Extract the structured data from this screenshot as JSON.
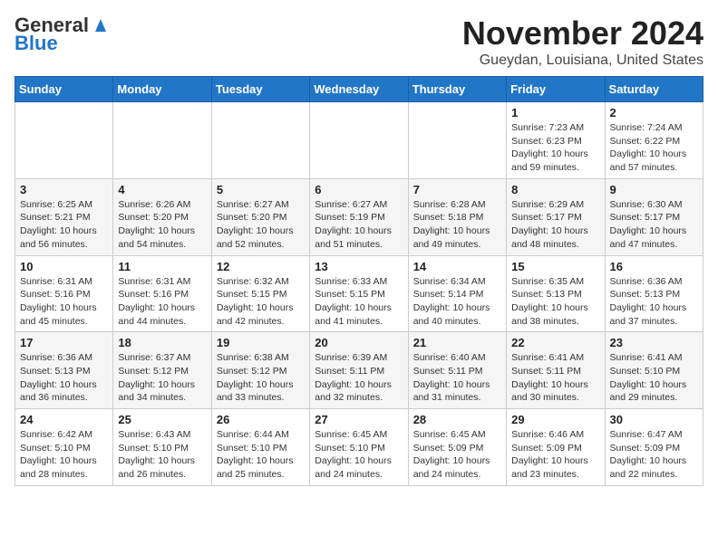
{
  "logo": {
    "line1": "General",
    "line2": "Blue"
  },
  "header": {
    "month": "November 2024",
    "location": "Gueydan, Louisiana, United States"
  },
  "weekdays": [
    "Sunday",
    "Monday",
    "Tuesday",
    "Wednesday",
    "Thursday",
    "Friday",
    "Saturday"
  ],
  "weeks": [
    [
      {
        "day": "",
        "info": ""
      },
      {
        "day": "",
        "info": ""
      },
      {
        "day": "",
        "info": ""
      },
      {
        "day": "",
        "info": ""
      },
      {
        "day": "",
        "info": ""
      },
      {
        "day": "1",
        "info": "Sunrise: 7:23 AM\nSunset: 6:23 PM\nDaylight: 10 hours\nand 59 minutes."
      },
      {
        "day": "2",
        "info": "Sunrise: 7:24 AM\nSunset: 6:22 PM\nDaylight: 10 hours\nand 57 minutes."
      }
    ],
    [
      {
        "day": "3",
        "info": "Sunrise: 6:25 AM\nSunset: 5:21 PM\nDaylight: 10 hours\nand 56 minutes."
      },
      {
        "day": "4",
        "info": "Sunrise: 6:26 AM\nSunset: 5:20 PM\nDaylight: 10 hours\nand 54 minutes."
      },
      {
        "day": "5",
        "info": "Sunrise: 6:27 AM\nSunset: 5:20 PM\nDaylight: 10 hours\nand 52 minutes."
      },
      {
        "day": "6",
        "info": "Sunrise: 6:27 AM\nSunset: 5:19 PM\nDaylight: 10 hours\nand 51 minutes."
      },
      {
        "day": "7",
        "info": "Sunrise: 6:28 AM\nSunset: 5:18 PM\nDaylight: 10 hours\nand 49 minutes."
      },
      {
        "day": "8",
        "info": "Sunrise: 6:29 AM\nSunset: 5:17 PM\nDaylight: 10 hours\nand 48 minutes."
      },
      {
        "day": "9",
        "info": "Sunrise: 6:30 AM\nSunset: 5:17 PM\nDaylight: 10 hours\nand 47 minutes."
      }
    ],
    [
      {
        "day": "10",
        "info": "Sunrise: 6:31 AM\nSunset: 5:16 PM\nDaylight: 10 hours\nand 45 minutes."
      },
      {
        "day": "11",
        "info": "Sunrise: 6:31 AM\nSunset: 5:16 PM\nDaylight: 10 hours\nand 44 minutes."
      },
      {
        "day": "12",
        "info": "Sunrise: 6:32 AM\nSunset: 5:15 PM\nDaylight: 10 hours\nand 42 minutes."
      },
      {
        "day": "13",
        "info": "Sunrise: 6:33 AM\nSunset: 5:15 PM\nDaylight: 10 hours\nand 41 minutes."
      },
      {
        "day": "14",
        "info": "Sunrise: 6:34 AM\nSunset: 5:14 PM\nDaylight: 10 hours\nand 40 minutes."
      },
      {
        "day": "15",
        "info": "Sunrise: 6:35 AM\nSunset: 5:13 PM\nDaylight: 10 hours\nand 38 minutes."
      },
      {
        "day": "16",
        "info": "Sunrise: 6:36 AM\nSunset: 5:13 PM\nDaylight: 10 hours\nand 37 minutes."
      }
    ],
    [
      {
        "day": "17",
        "info": "Sunrise: 6:36 AM\nSunset: 5:13 PM\nDaylight: 10 hours\nand 36 minutes."
      },
      {
        "day": "18",
        "info": "Sunrise: 6:37 AM\nSunset: 5:12 PM\nDaylight: 10 hours\nand 34 minutes."
      },
      {
        "day": "19",
        "info": "Sunrise: 6:38 AM\nSunset: 5:12 PM\nDaylight: 10 hours\nand 33 minutes."
      },
      {
        "day": "20",
        "info": "Sunrise: 6:39 AM\nSunset: 5:11 PM\nDaylight: 10 hours\nand 32 minutes."
      },
      {
        "day": "21",
        "info": "Sunrise: 6:40 AM\nSunset: 5:11 PM\nDaylight: 10 hours\nand 31 minutes."
      },
      {
        "day": "22",
        "info": "Sunrise: 6:41 AM\nSunset: 5:11 PM\nDaylight: 10 hours\nand 30 minutes."
      },
      {
        "day": "23",
        "info": "Sunrise: 6:41 AM\nSunset: 5:10 PM\nDaylight: 10 hours\nand 29 minutes."
      }
    ],
    [
      {
        "day": "24",
        "info": "Sunrise: 6:42 AM\nSunset: 5:10 PM\nDaylight: 10 hours\nand 28 minutes."
      },
      {
        "day": "25",
        "info": "Sunrise: 6:43 AM\nSunset: 5:10 PM\nDaylight: 10 hours\nand 26 minutes."
      },
      {
        "day": "26",
        "info": "Sunrise: 6:44 AM\nSunset: 5:10 PM\nDaylight: 10 hours\nand 25 minutes."
      },
      {
        "day": "27",
        "info": "Sunrise: 6:45 AM\nSunset: 5:10 PM\nDaylight: 10 hours\nand 24 minutes."
      },
      {
        "day": "28",
        "info": "Sunrise: 6:45 AM\nSunset: 5:09 PM\nDaylight: 10 hours\nand 24 minutes."
      },
      {
        "day": "29",
        "info": "Sunrise: 6:46 AM\nSunset: 5:09 PM\nDaylight: 10 hours\nand 23 minutes."
      },
      {
        "day": "30",
        "info": "Sunrise: 6:47 AM\nSunset: 5:09 PM\nDaylight: 10 hours\nand 22 minutes."
      }
    ]
  ]
}
